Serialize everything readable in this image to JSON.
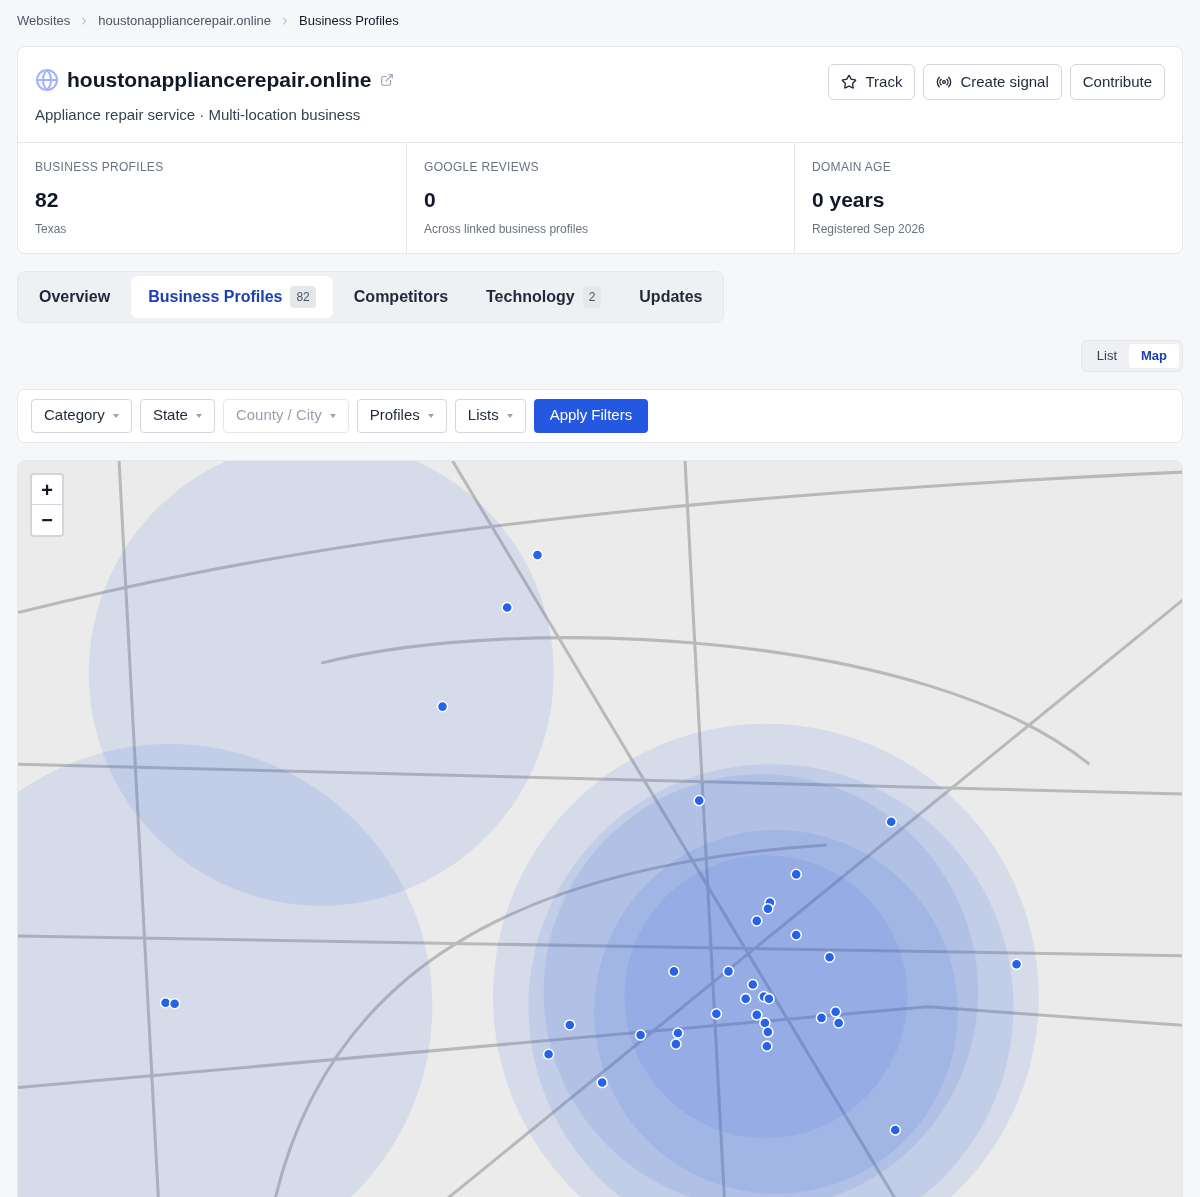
{
  "breadcrumbs": [
    {
      "label": "Websites",
      "current": false
    },
    {
      "label": "houstonappliancerepair.online",
      "current": false
    },
    {
      "label": "Business Profiles",
      "current": true
    }
  ],
  "header": {
    "title": "houstonappliancerepair.online",
    "subtitle": "Appliance repair service · Multi-location business",
    "actions": [
      {
        "kind": "track",
        "label": "Track"
      },
      {
        "kind": "signal",
        "label": "Create signal"
      },
      {
        "kind": "plain",
        "label": "Contribute"
      }
    ]
  },
  "stats": [
    {
      "label": "BUSINESS PROFILES",
      "value": "82",
      "note": "Texas"
    },
    {
      "label": "GOOGLE REVIEWS",
      "value": "0",
      "note": "Across linked business profiles"
    },
    {
      "label": "DOMAIN AGE",
      "value": "0 years",
      "note": "Registered Sep 2026"
    }
  ],
  "tabs": [
    {
      "label": "Overview",
      "selected": false
    },
    {
      "label": "Business Profiles",
      "count": "82",
      "selected": true
    },
    {
      "label": "Competitors",
      "selected": false
    },
    {
      "label": "Technology",
      "count": "2",
      "selected": false
    },
    {
      "label": "Updates",
      "selected": false
    }
  ],
  "view_toggle": [
    {
      "label": "List",
      "selected": false
    },
    {
      "label": "Map",
      "selected": true
    }
  ],
  "filters": [
    {
      "label": "Category",
      "disabled": false
    },
    {
      "label": "State",
      "disabled": false
    },
    {
      "label": "County / City",
      "disabled": true
    },
    {
      "label": "Profiles",
      "disabled": false
    },
    {
      "label": "Lists",
      "disabled": false
    }
  ],
  "apply_button": "Apply Filters",
  "map": {
    "zoom_in": "+",
    "zoom_out": "−"
  }
}
